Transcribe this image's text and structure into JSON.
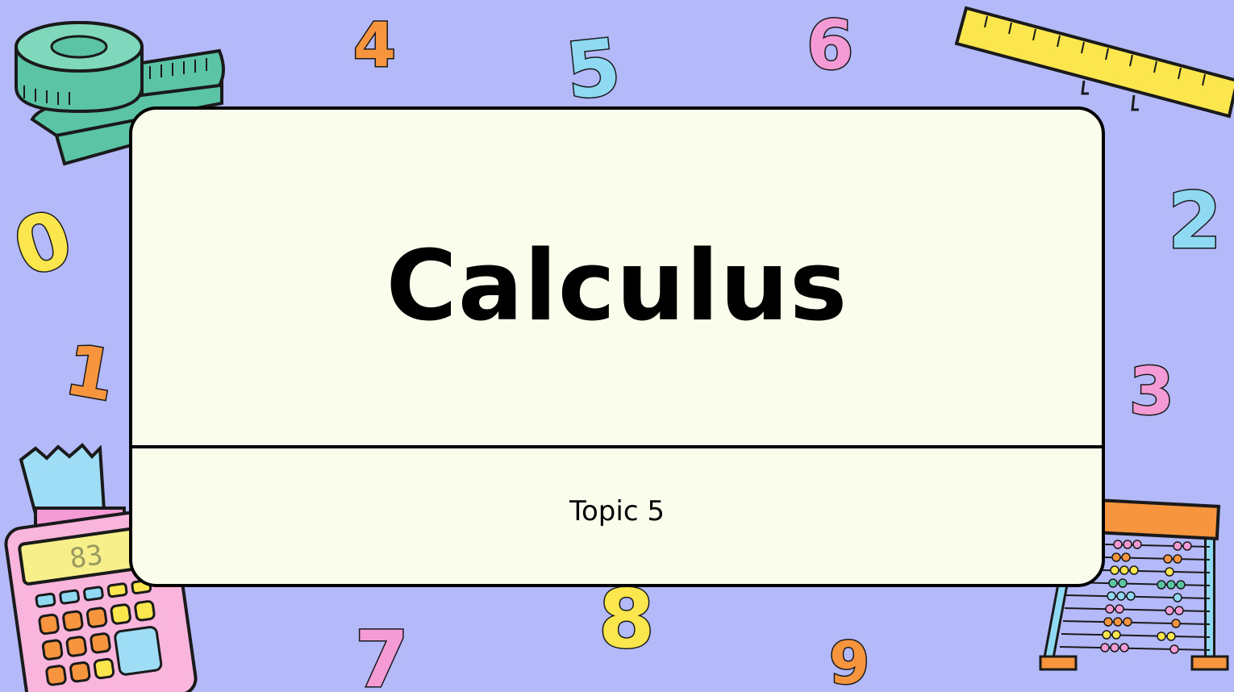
{
  "slide": {
    "title": "Calculus",
    "subtitle": "Topic 5"
  },
  "digits": {
    "d0": "0",
    "d1": "1",
    "d2": "2",
    "d3": "3",
    "d4": "4",
    "d5": "5",
    "d6": "6",
    "d7": "7",
    "d8": "8",
    "d9": "9"
  },
  "calculator": {
    "display": "83"
  },
  "colors": {
    "background": "#b3b9f9",
    "card": "#fbfdec",
    "orange": "#f7953f",
    "blue": "#8fd9f2",
    "pink": "#f49ad4",
    "yellow": "#fbe64d",
    "teal": "#5ac4a4"
  },
  "icons": [
    "tape-measure-icon",
    "ruler-icon",
    "calculator-icon",
    "abacus-icon"
  ]
}
